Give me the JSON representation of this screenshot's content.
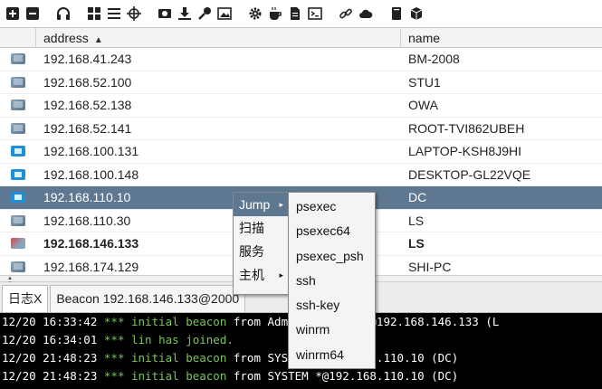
{
  "toolbar": {
    "icons": [
      "plus-square-icon",
      "minus-square-icon",
      "headphones-icon",
      "graph-icon",
      "list-icon",
      "crosshair-icon",
      "image-icon",
      "download-icon",
      "key-icon",
      "screenshot-icon",
      "gear-icon",
      "coffee-icon",
      "document-icon",
      "terminal-icon",
      "link-icon",
      "cloud-icon",
      "book-icon",
      "cube-icon"
    ]
  },
  "table": {
    "columns": {
      "address": "address",
      "name": "name",
      "sort_indicator": "▲"
    },
    "rows": [
      {
        "address": "192.168.41.243",
        "name": "BM-2008",
        "os": "xp"
      },
      {
        "address": "192.168.52.100",
        "name": "STU1",
        "os": "xp"
      },
      {
        "address": "192.168.52.138",
        "name": "OWA",
        "os": "xp"
      },
      {
        "address": "192.168.52.141",
        "name": "ROOT-TVI862UBEH",
        "os": "xp"
      },
      {
        "address": "192.168.100.131",
        "name": "LAPTOP-KSH8J9HI",
        "os": "win10"
      },
      {
        "address": "192.168.100.148",
        "name": "DESKTOP-GL22VQE",
        "os": "win10"
      },
      {
        "address": "192.168.110.10",
        "name": "DC",
        "os": "win10"
      },
      {
        "address": "192.168.110.30",
        "name": "LS",
        "os": "xp"
      },
      {
        "address": "192.168.146.133",
        "name": "LS",
        "os": "red"
      },
      {
        "address": "192.168.174.129",
        "name": "SHI-PC",
        "os": "xp"
      }
    ],
    "selected_index": 6,
    "bold_index": 8
  },
  "tabs": [
    {
      "label": "日志X"
    },
    {
      "label": "Beacon 192.168.146.133@2000"
    }
  ],
  "console": {
    "lines": [
      {
        "ts": "12/20 16:33:42",
        "stars": "***",
        "event": "initial beacon",
        "tail": " from Administrator *@192.168.146.133 (L"
      },
      {
        "ts": "12/20 16:34:01",
        "stars": "***",
        "event": "lin has joined.",
        "tail": ""
      },
      {
        "ts": "12/20 21:48:23",
        "stars": "***",
        "event": "initial beacon",
        "tail": " from SYSTEM *@192.168.110.10 (DC)"
      },
      {
        "ts": "12/20 21:48:23",
        "stars": "***",
        "event": "initial beacon",
        "tail": " from SYSTEM *@192.168.110.10 (DC)"
      }
    ]
  },
  "context_menu": {
    "items": [
      {
        "label": "Jump",
        "has_submenu": true
      },
      {
        "label": "扫描",
        "has_submenu": false
      },
      {
        "label": "服务",
        "has_submenu": false
      },
      {
        "label": "主机",
        "has_submenu": true
      }
    ],
    "submenu_arrow": "▸",
    "submenu": [
      "psexec",
      "psexec64",
      "psexec_psh",
      "ssh",
      "ssh-key",
      "winrm",
      "winrm64"
    ]
  },
  "colors": {
    "selection": "#5f7891",
    "console_bg": "#000000",
    "console_event": "#7cc35d"
  }
}
